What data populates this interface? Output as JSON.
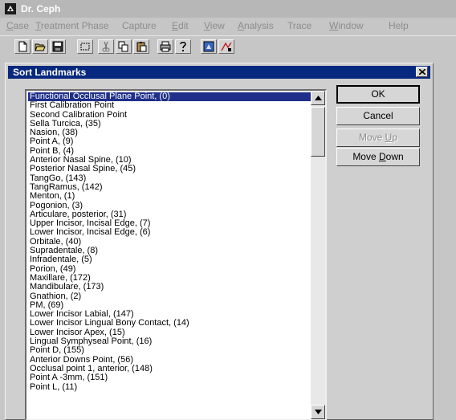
{
  "window": {
    "title": "Dr. Ceph",
    "icon": "app-icon"
  },
  "menu": [
    {
      "label": "Case",
      "accel": "C",
      "rest": "ase"
    },
    {
      "label": "Treatment Phase",
      "accel": "T",
      "rest": "reatment Phase"
    },
    {
      "label": "Capture",
      "accel": "",
      "rest": "Capture"
    },
    {
      "label": "Edit",
      "accel": "E",
      "rest": "dit"
    },
    {
      "label": "View",
      "accel": "V",
      "rest": "iew"
    },
    {
      "label": "Analysis",
      "accel": "A",
      "rest": "nalysis"
    },
    {
      "label": "Trace",
      "accel": "",
      "rest": "Trace"
    },
    {
      "label": "Window",
      "accel": "W",
      "rest": "indow"
    },
    {
      "label": "Help",
      "accel": "",
      "rest": "Help"
    }
  ],
  "toolbar": [
    {
      "name": "new-file-icon"
    },
    {
      "name": "open-folder-icon"
    },
    {
      "name": "save-disk-icon"
    },
    {
      "name": "select-rectangle-icon"
    },
    {
      "name": "cut-scissors-icon"
    },
    {
      "name": "copy-icon"
    },
    {
      "name": "paste-clipboard-icon"
    },
    {
      "name": "print-icon"
    },
    {
      "name": "help-question-icon"
    },
    {
      "name": "image-capture-icon"
    },
    {
      "name": "trace-tool-icon"
    }
  ],
  "dialog": {
    "title": "Sort Landmarks",
    "close_icon": "close-x-icon",
    "buttons": {
      "ok": "OK",
      "cancel": "Cancel",
      "move_up": {
        "accel_prefix": "Move ",
        "accel": "U",
        "rest": "p"
      },
      "move_down": {
        "accel_prefix": "Move ",
        "accel": "D",
        "rest": "own"
      }
    },
    "selected_index": 0,
    "landmarks": [
      "Functional Occlusal Plane Point, (0)",
      "First Calibration Point",
      "Second Calibration Point",
      "Sella Turcica, (35)",
      "Nasion, (38)",
      "Point A, (9)",
      "Point B, (4)",
      "Anterior Nasal Spine, (10)",
      "Posterior Nasal Spine, (45)",
      "TangGo, (143)",
      "TangRamus, (142)",
      "Menton, (1)",
      "Pogonion, (3)",
      "Articulare, posterior, (31)",
      "Upper Incisor, Incisal Edge, (7)",
      "Lower Incisor, Incisal Edge, (6)",
      "Orbitale, (40)",
      "Supradentale, (8)",
      "Infradentale, (5)",
      "Porion, (49)",
      "Maxillare, (172)",
      "Mandibulare, (173)",
      "Gnathion, (2)",
      "PM, (69)",
      "Lower Incisor Labial, (147)",
      "Lower Incisor Lingual Bony Contact, (14)",
      "Lower Incisor Apex, (15)",
      "Lingual Symphyseal Point, (16)",
      "Point D, (155)",
      "Anterior Downs Point, (56)",
      "Occlusal point 1, anterior, (148)",
      "Point A -3mm, (151)",
      "Point L, (11)"
    ]
  },
  "colors": {
    "dialog_title_bg": "#06287e",
    "selection_bg": "#1f2f8a",
    "disabled_text": "#8c8c8c"
  }
}
